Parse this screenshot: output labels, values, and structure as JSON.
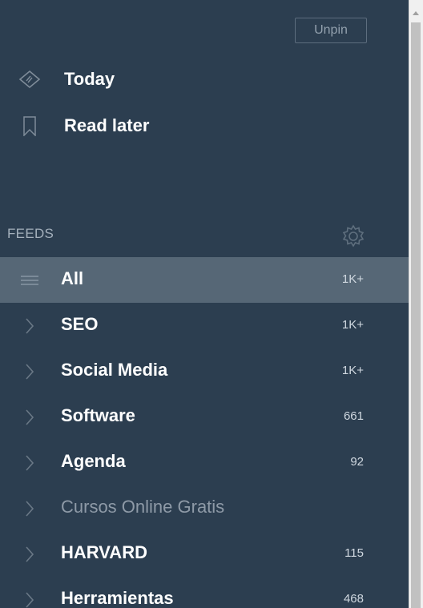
{
  "header": {
    "unpin_label": "Unpin"
  },
  "nav": {
    "today": {
      "label": "Today",
      "icon": "today-icon"
    },
    "read_later": {
      "label": "Read later",
      "icon": "bookmark-icon"
    }
  },
  "feeds": {
    "section_label": "FEEDS",
    "settings_icon": "gear-icon",
    "items": [
      {
        "name": "All",
        "count": "1K+",
        "selected": true,
        "muted": false
      },
      {
        "name": "SEO",
        "count": "1K+",
        "selected": false,
        "muted": false
      },
      {
        "name": "Social Media",
        "count": "1K+",
        "selected": false,
        "muted": false
      },
      {
        "name": "Software",
        "count": "661",
        "selected": false,
        "muted": false
      },
      {
        "name": "Agenda",
        "count": "92",
        "selected": false,
        "muted": false
      },
      {
        "name": "Cursos Online Gratis",
        "count": "",
        "selected": false,
        "muted": true
      },
      {
        "name": "HARVARD",
        "count": "115",
        "selected": false,
        "muted": false
      },
      {
        "name": "Herramientas",
        "count": "468",
        "selected": false,
        "muted": false
      }
    ]
  },
  "colors": {
    "panel_bg": "#2c3e50",
    "selected_bg": "#566776",
    "text": "#ffffff",
    "muted_text": "#8e9aa7"
  }
}
